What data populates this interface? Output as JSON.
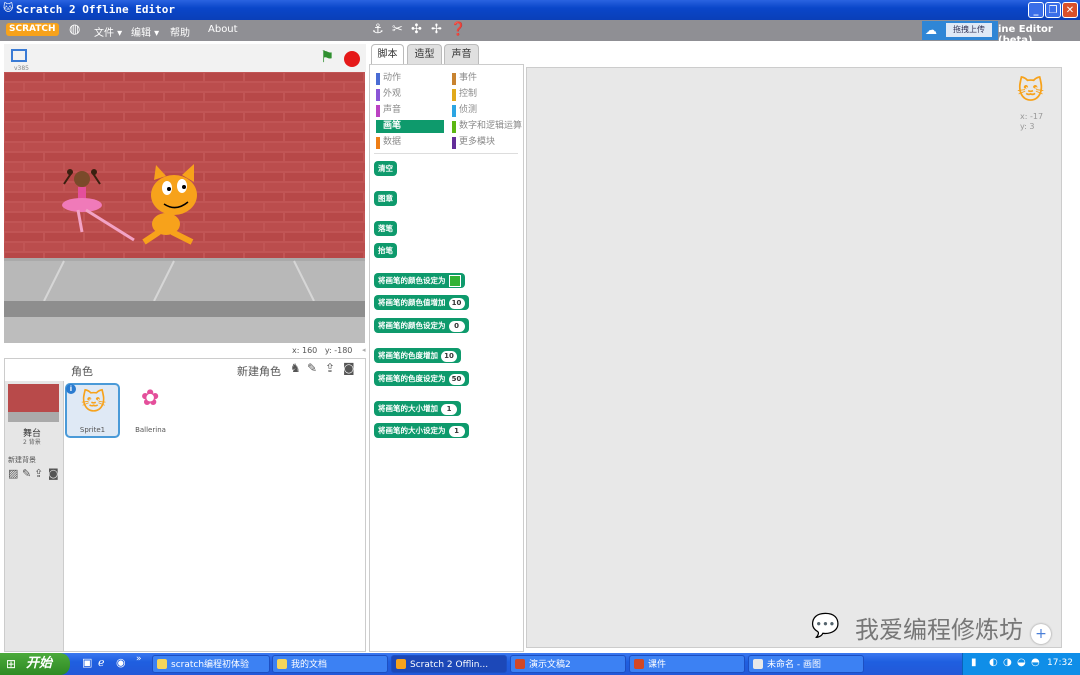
{
  "window": {
    "title": "Scratch 2 Offline Editor",
    "buttons": {
      "minimize": "_",
      "maximize": "❐",
      "close": "✕"
    }
  },
  "menubar": {
    "logo": "SCRATCH",
    "file": "文件 ▾",
    "edit": "编辑 ▾",
    "help": "帮助",
    "about": "About",
    "upload_label": "拖拽上传",
    "editor_suffix": "ine Editor (beta)"
  },
  "stage": {
    "version": "v385",
    "coord_x_label": "x:",
    "coord_x": "160",
    "coord_y_label": "y:",
    "coord_y": "-180"
  },
  "sprites": {
    "header": "角色",
    "new_sprite": "新建角色",
    "stage_label": "舞台",
    "backdrop_count": "2 背景",
    "new_backdrop": "新建背景",
    "items": [
      {
        "name": "Sprite1",
        "selected": true
      },
      {
        "name": "Ballerina",
        "selected": false
      }
    ]
  },
  "tabs": [
    "脚本",
    "造型",
    "声音"
  ],
  "categories": [
    {
      "label": "动作",
      "color": "#4a6cd4"
    },
    {
      "label": "事件",
      "color": "#c88330"
    },
    {
      "label": "外观",
      "color": "#8a55d7"
    },
    {
      "label": "控制",
      "color": "#e1a91a"
    },
    {
      "label": "声音",
      "color": "#bb42c3"
    },
    {
      "label": "侦测",
      "color": "#2ca5e2"
    },
    {
      "label": "画笔",
      "color": "#0e9a6c",
      "selected": true
    },
    {
      "label": "数字和逻辑运算",
      "color": "#5cb712"
    },
    {
      "label": "数据",
      "color": "#ee7d16"
    },
    {
      "label": "更多模块",
      "color": "#632d99"
    }
  ],
  "blocks": [
    {
      "label": "清空"
    },
    {
      "label": "图章"
    },
    {
      "label": "落笔"
    },
    {
      "label": "抬笔"
    },
    {
      "label": "将画笔的颜色设定为",
      "swatch": "#31b336"
    },
    {
      "label": "将画笔的颜色值增加",
      "arg": "10"
    },
    {
      "label": "将画笔的颜色设定为",
      "arg": "0"
    },
    {
      "label": "将画笔的色度增加",
      "arg": "10"
    },
    {
      "label": "将画笔的色度设定为",
      "arg": "50"
    },
    {
      "label": "将画笔的大小增加",
      "arg": "1"
    },
    {
      "label": "将画笔的大小设定为",
      "arg": "1"
    }
  ],
  "script_area": {
    "sprite_x": "x: -17",
    "sprite_y": "y: 3"
  },
  "watermark": "我爱编程修炼坊",
  "taskbar": {
    "start": "开始",
    "tasks": [
      {
        "label": "scratch编程初体验"
      },
      {
        "label": "我的文档"
      },
      {
        "label": "Scratch 2 Offlin...",
        "active": true
      },
      {
        "label": "演示文稿2"
      },
      {
        "label": "课件"
      },
      {
        "label": "未命名 - 画图"
      }
    ],
    "clock": "17:32"
  },
  "colors": {
    "pen_green": "#0e9a6c",
    "menubar_gray": "#8f8f94",
    "titlebar_blue": "#0a46c9",
    "brick": "#b84a4a"
  }
}
